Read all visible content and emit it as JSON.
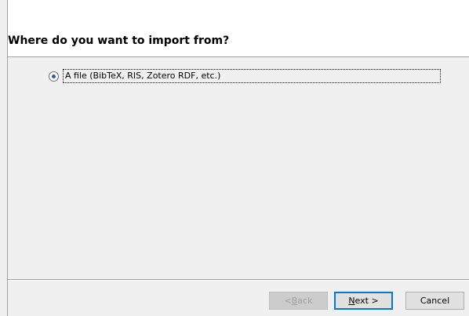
{
  "header": {
    "title": "Where do you want to import from?"
  },
  "options": [
    {
      "label": "A file (BibTeX, RIS, Zotero RDF, etc.)",
      "selected": true
    }
  ],
  "buttons": {
    "back": {
      "prefix": "< ",
      "mnemonic": "B",
      "rest": "ack",
      "enabled": false
    },
    "next": {
      "mnemonic": "N",
      "rest": "ext >",
      "enabled": true
    },
    "cancel": {
      "label": "Cancel",
      "enabled": true
    }
  },
  "colors": {
    "accent": "#0078d7",
    "radio_dot": "#2b5fb1"
  }
}
